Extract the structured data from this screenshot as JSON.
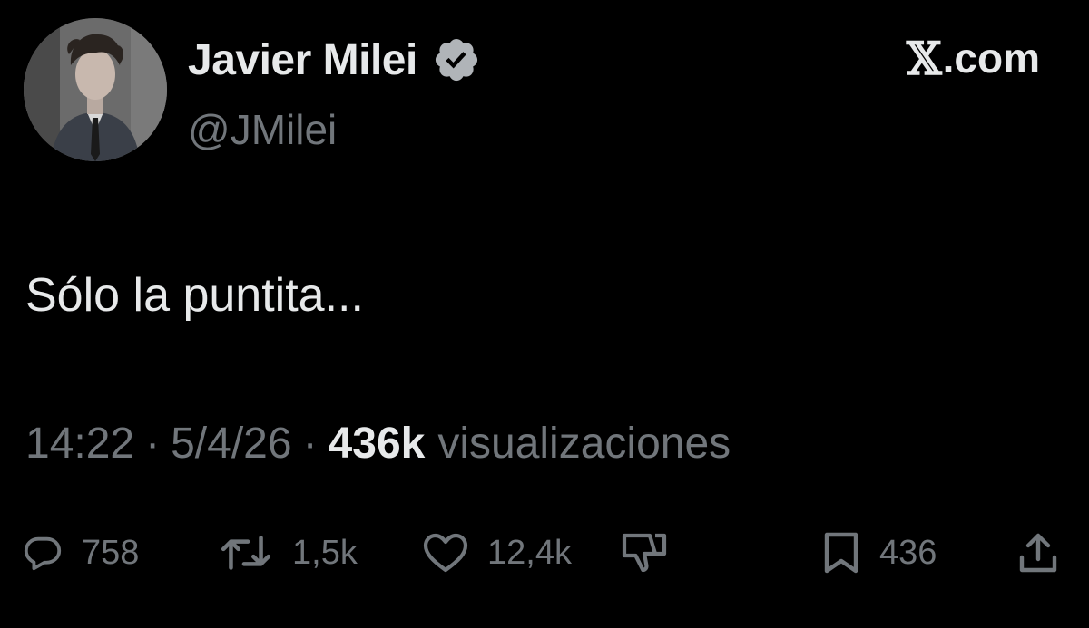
{
  "author": {
    "display_name": "Javier Milei",
    "handle": "@JMilei",
    "verified": true,
    "avatar_icon": "avatar-photo"
  },
  "brand": {
    "x_glyph": "𝕏",
    "suffix": ".com"
  },
  "tweet": {
    "text": "Sólo la puntita..."
  },
  "meta": {
    "time": "14:22",
    "separator": "·",
    "date": "5/4/26",
    "views_count": "436k",
    "views_label": "visualizaciones"
  },
  "actions": {
    "replies": {
      "icon": "reply-icon",
      "count": "758"
    },
    "reposts": {
      "icon": "repost-icon",
      "count": "1,5k"
    },
    "likes": {
      "icon": "heart-icon",
      "count": "12,4k"
    },
    "dislike": {
      "icon": "thumbs-down-icon"
    },
    "bookmarks": {
      "icon": "bookmark-icon",
      "count": "436"
    },
    "share": {
      "icon": "share-icon"
    }
  },
  "colors": {
    "background": "#000000",
    "primary_text": "#e7e9ea",
    "secondary_text": "#71767b",
    "verified_badge": "#b0b4b8"
  }
}
